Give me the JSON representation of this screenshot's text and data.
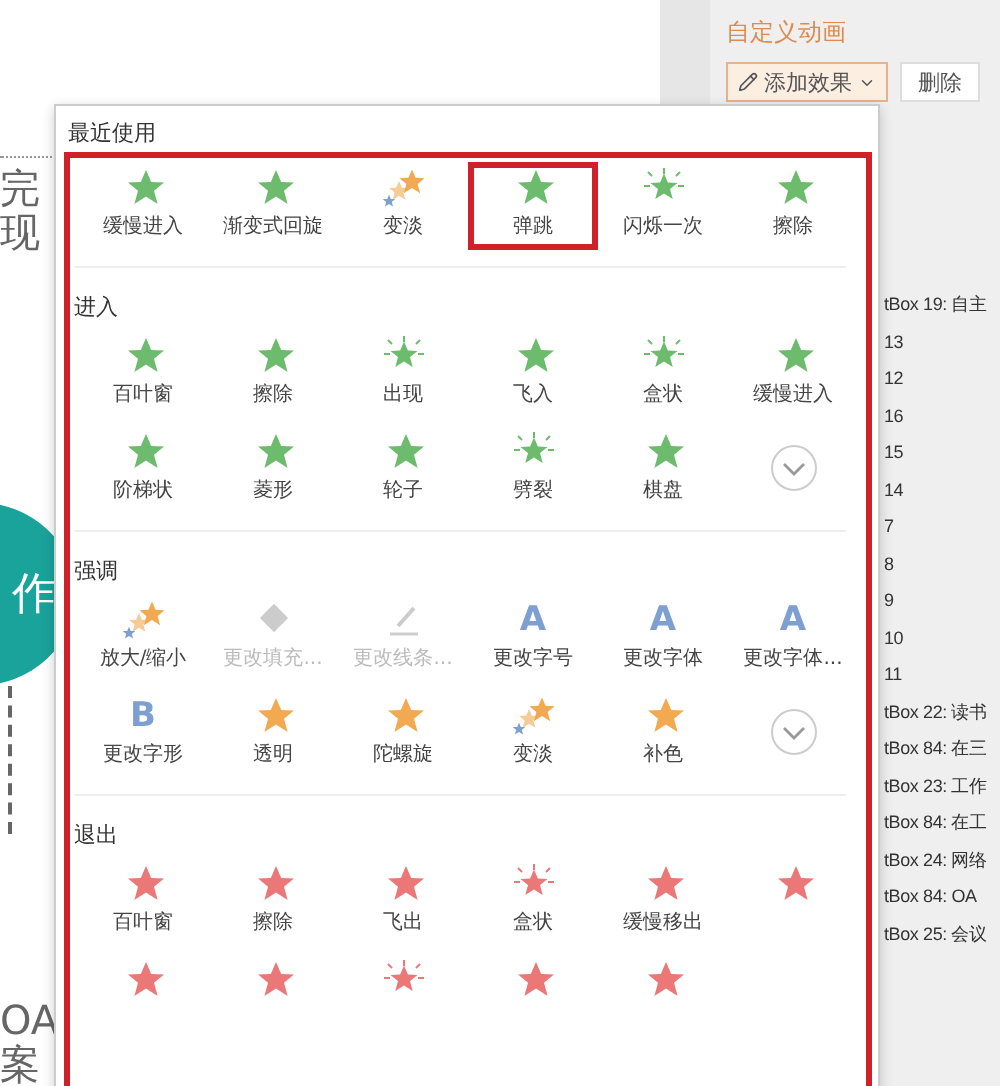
{
  "slide": {
    "lines": [
      {
        "text": "完"
      },
      {
        "text": "现"
      }
    ],
    "badge": "作",
    "footer": [
      {
        "text": "OA"
      },
      {
        "text": "案"
      }
    ]
  },
  "panel": {
    "title": "自定义动画",
    "add_button": "添加效果",
    "delete_button": "删除",
    "items": [
      "tBox 19: 自主",
      "13",
      "12",
      "16",
      "15",
      "14",
      "7",
      "8",
      "9",
      "10",
      "11",
      "tBox 22: 读书",
      "tBox 84: 在三",
      "tBox 23: 工作",
      "tBox 84: 在工",
      "tBox 24: 网络",
      "tBox 84: OA",
      "tBox 25: 会议"
    ]
  },
  "menu": {
    "sections": [
      {
        "title": "最近使用",
        "items": [
          {
            "label": "缓慢进入",
            "kind": "star",
            "color": "#6dbb6d",
            "selected": false
          },
          {
            "label": "渐变式回旋",
            "kind": "star",
            "color": "#6dbb6d",
            "selected": false
          },
          {
            "label": "变淡",
            "kind": "stars",
            "color": "#f2a950",
            "selected": false
          },
          {
            "label": "弹跳",
            "kind": "star",
            "color": "#6dbb6d",
            "selected": true
          },
          {
            "label": "闪烁一次",
            "kind": "burst",
            "color": "#6dbb6d",
            "selected": false
          },
          {
            "label": "擦除",
            "kind": "star",
            "color": "#6dbb6d",
            "selected": false
          }
        ]
      },
      {
        "title": "进入",
        "items": [
          {
            "label": "百叶窗",
            "kind": "star",
            "color": "#6dbb6d",
            "selected": false
          },
          {
            "label": "擦除",
            "kind": "star",
            "color": "#6dbb6d",
            "selected": false
          },
          {
            "label": "出现",
            "kind": "burst",
            "color": "#6dbb6d",
            "selected": false
          },
          {
            "label": "飞入",
            "kind": "star",
            "color": "#6dbb6d",
            "selected": false
          },
          {
            "label": "盒状",
            "kind": "burst",
            "color": "#6dbb6d",
            "selected": false
          },
          {
            "label": "缓慢进入",
            "kind": "star",
            "color": "#6dbb6d",
            "selected": false
          },
          {
            "label": "阶梯状",
            "kind": "star",
            "color": "#6dbb6d",
            "selected": false
          },
          {
            "label": "菱形",
            "kind": "star",
            "color": "#6dbb6d",
            "selected": false
          },
          {
            "label": "轮子",
            "kind": "star",
            "color": "#6dbb6d",
            "selected": false
          },
          {
            "label": "劈裂",
            "kind": "burst",
            "color": "#6dbb6d",
            "selected": false
          },
          {
            "label": "棋盘",
            "kind": "star",
            "color": "#6dbb6d",
            "selected": false
          },
          {
            "kind": "more"
          }
        ]
      },
      {
        "title": "强调",
        "items": [
          {
            "label": "放大/缩小",
            "kind": "stars",
            "color": "#f2a950",
            "selected": false
          },
          {
            "label": "更改填充...",
            "kind": "fill",
            "color": "#cccccc",
            "selected": false,
            "disabled": true
          },
          {
            "label": "更改线条...",
            "kind": "line",
            "color": "#cccccc",
            "selected": false,
            "disabled": true
          },
          {
            "label": "更改字号",
            "kind": "letter",
            "glyph": "A",
            "color": "#7ea0d0",
            "selected": false
          },
          {
            "label": "更改字体",
            "kind": "letter",
            "glyph": "A",
            "color": "#7ea0d0",
            "selected": false
          },
          {
            "label": "更改字体...",
            "kind": "letter",
            "glyph": "A",
            "color": "#7ea0d0",
            "selected": false
          },
          {
            "label": "更改字形",
            "kind": "letter",
            "glyph": "B",
            "color": "#7ea0d0",
            "selected": false
          },
          {
            "label": "透明",
            "kind": "star",
            "color": "#f2a950",
            "selected": false
          },
          {
            "label": "陀螺旋",
            "kind": "star",
            "color": "#f2a950",
            "selected": false
          },
          {
            "label": "变淡",
            "kind": "stars",
            "color": "#f2a950",
            "selected": false
          },
          {
            "label": "补色",
            "kind": "star",
            "color": "#f2a950",
            "selected": false
          },
          {
            "kind": "more"
          }
        ]
      },
      {
        "title": "退出",
        "items": [
          {
            "label": "百叶窗",
            "kind": "star",
            "color": "#ec7777",
            "selected": false
          },
          {
            "label": "擦除",
            "kind": "star",
            "color": "#ec7777",
            "selected": false
          },
          {
            "label": "飞出",
            "kind": "star",
            "color": "#ec7777",
            "selected": false
          },
          {
            "label": "盒状",
            "kind": "burst",
            "color": "#ec7777",
            "selected": false
          },
          {
            "label": "缓慢移出",
            "kind": "star",
            "color": "#ec7777",
            "selected": false
          },
          {
            "kind": "star",
            "color": "#ec7777",
            "selected": false
          },
          {
            "kind": "star",
            "color": "#ec7777",
            "selected": false
          },
          {
            "kind": "star",
            "color": "#ec7777",
            "selected": false
          },
          {
            "kind": "burst",
            "color": "#ec7777",
            "selected": false
          },
          {
            "kind": "star",
            "color": "#ec7777",
            "selected": false
          },
          {
            "kind": "star",
            "color": "#ec7777",
            "selected": false
          }
        ]
      }
    ]
  }
}
